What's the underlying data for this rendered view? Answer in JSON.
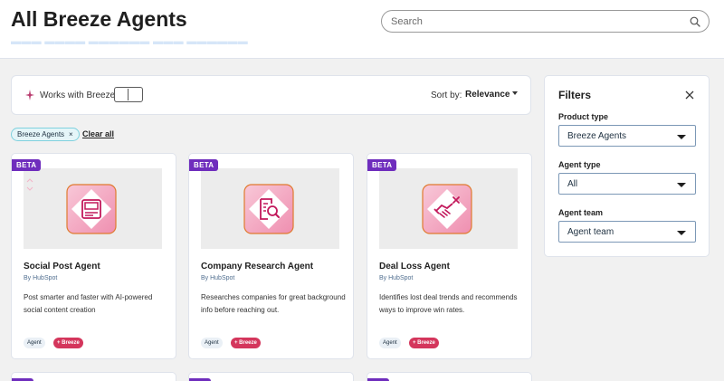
{
  "header": {
    "title": "All Breeze Agents",
    "search_placeholder": "Search"
  },
  "toolbar": {
    "works_with_label": "Works with Breeze",
    "sort_label": "Sort by:",
    "sort_value": "Relevance"
  },
  "active_filters": {
    "chip_label": "Breeze Agents",
    "chip_close": "×",
    "clear_all": "Clear all"
  },
  "cards": [
    {
      "badge": "BETA",
      "title": "Social Post Agent",
      "by": "By HubSpot",
      "description": "Post smarter and faster with AI-powered social content creation",
      "tags": [
        "Agent",
        "+ Breeze"
      ],
      "icon": "image-gallery-icon"
    },
    {
      "badge": "BETA",
      "title": "Company Research Agent",
      "by": "By HubSpot",
      "description": "Researches companies for great background info before reaching out.",
      "tags": [
        "Agent",
        "+ Breeze"
      ],
      "icon": "document-search-icon"
    },
    {
      "badge": "BETA",
      "title": "Deal Loss Agent",
      "by": "By HubSpot",
      "description": "Identifies lost deal trends and recommends ways to improve win rates.",
      "tags": [
        "Agent",
        "+ Breeze"
      ],
      "icon": "handshake-x-icon"
    }
  ],
  "filters": {
    "title": "Filters",
    "product_type": {
      "label": "Product type",
      "value": "Breeze Agents"
    },
    "agent_type": {
      "label": "Agent type",
      "value": "All"
    },
    "agent_team": {
      "label": "Agent team",
      "value": "Agent team"
    }
  },
  "colors": {
    "beta_badge": "#6f2dbd",
    "breeze_tag": "#d4365c",
    "icon_gradient_start": "#f8c8d8",
    "icon_gradient_end": "#c2185b"
  }
}
